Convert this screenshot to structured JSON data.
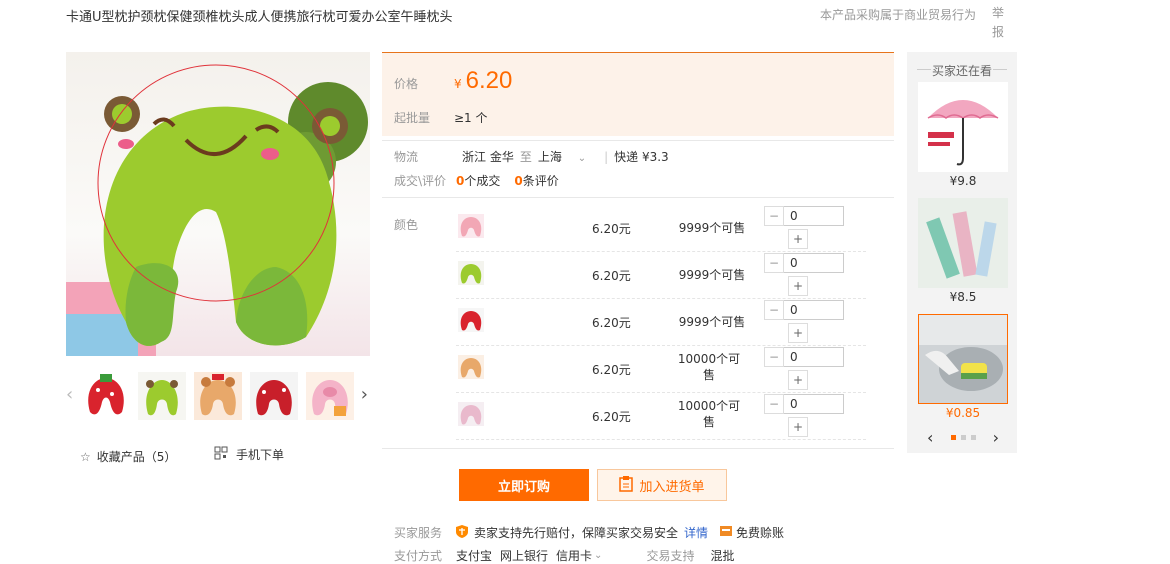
{
  "product": {
    "title": "卡通U型枕护颈枕保健颈椎枕头成人便携旅行枕可爱办公室午睡枕头",
    "report_note": "本产品采购属于商业贸易行为",
    "report_link": "举报"
  },
  "price": {
    "label": "价格",
    "currency": "¥",
    "value": "6.20",
    "moq_label": "起批量",
    "moq_value": "≥1 个"
  },
  "logistics": {
    "label": "物流",
    "from": "浙江 金华",
    "to_word": "至",
    "to": "上海",
    "express": "快递 ¥3.3"
  },
  "deals": {
    "label": "成交\\评价",
    "deal_count": "0",
    "deal_text": "个成交",
    "review_count": "0",
    "review_text": "条评价"
  },
  "skus": {
    "label": "颜色",
    "items": [
      {
        "price": "6.20元",
        "stock": "9999个可售",
        "qty": "0",
        "color": "#f2a7b5"
      },
      {
        "price": "6.20元",
        "stock": "9999个可售",
        "qty": "0",
        "color": "#9ccb2e"
      },
      {
        "price": "6.20元",
        "stock": "9999个可售",
        "qty": "0",
        "color": "#d9232d"
      },
      {
        "price": "6.20元",
        "stock": "10000个可售",
        "qty": "0",
        "color": "#e8a86a"
      },
      {
        "price": "6.20元",
        "stock": "10000个可售",
        "qty": "0",
        "color": "#e9b9cc"
      }
    ],
    "minus_symbol": "−",
    "plus_symbol": "+"
  },
  "actions": {
    "buy_label": "立即订购",
    "cart_label": "加入进货单"
  },
  "gallery": {
    "fav_label": "收藏产品（5）",
    "mobile_label": "手机下单",
    "prev_symbol": "‹",
    "next_symbol": "›"
  },
  "service": {
    "label": "买家服务",
    "guarantee": "卖家支持先行赔付，保障买家交易安全",
    "detail_link": "详情",
    "free_claim": "免费赊账"
  },
  "payment": {
    "label": "支付方式",
    "methods": [
      "支付宝",
      "网上银行",
      "信用卡"
    ],
    "trade_label": "交易支持",
    "trade_value": "混批"
  },
  "side_panel": {
    "title": "买家还在看",
    "items": [
      {
        "price": "¥9.8"
      },
      {
        "price": "¥8.5"
      },
      {
        "price": "¥0.85"
      }
    ],
    "prev_symbol": "‹",
    "next_symbol": "›"
  },
  "colors": {
    "accent": "#ff6a00",
    "price_bg": "#fdf2e9",
    "frog_green": "#9ccb2e"
  }
}
